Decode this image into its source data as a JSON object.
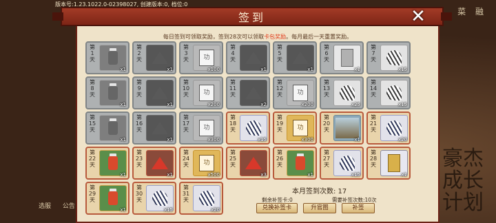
{
  "status": {
    "version_text": "版本号:1.23.1022.0-02398027, 创建版本:0, 档位:0"
  },
  "dialog": {
    "title": "签到",
    "close_label": "✕",
    "info_prefix": "每日签到可领取奖励，签到28次可以领取",
    "info_highlight": "卡包奖励",
    "info_suffix": "。每月最后一天重置奖励。"
  },
  "background": {
    "top_right_glyphs": [
      "菜",
      "融"
    ],
    "bottom_left_glyphs": [
      "选服",
      "公告"
    ],
    "logo_text": "豪杰成长计划"
  },
  "days": [
    {
      "label": "第1天",
      "qty": "x1",
      "item": "lantern",
      "claimed": true
    },
    {
      "label": "第2天",
      "qty": "x1",
      "item": "cloth",
      "claimed": true
    },
    {
      "label": "第3天",
      "qty": "x100",
      "item": "scroll",
      "claimed": true
    },
    {
      "label": "第4天",
      "qty": "x1",
      "item": "cloth",
      "claimed": true
    },
    {
      "label": "第5天",
      "qty": "x1",
      "item": "cloth",
      "claimed": true
    },
    {
      "label": "第6天",
      "qty": "x1",
      "item": "card",
      "claimed": true
    },
    {
      "label": "第7天",
      "qty": "x15",
      "item": "feather",
      "claimed": true
    },
    {
      "label": "第8天",
      "qty": "x1",
      "item": "lantern",
      "claimed": true
    },
    {
      "label": "第9天",
      "qty": "x1",
      "item": "cloth",
      "claimed": true
    },
    {
      "label": "第10天",
      "qty": "x200",
      "item": "scroll",
      "claimed": true
    },
    {
      "label": "第11天",
      "qty": "x2",
      "item": "cloth",
      "claimed": true
    },
    {
      "label": "第12天",
      "qty": "x200",
      "item": "scroll",
      "claimed": true
    },
    {
      "label": "第13天",
      "qty": "x25",
      "item": "feather",
      "claimed": true
    },
    {
      "label": "第14天",
      "qty": "x15",
      "item": "feather",
      "claimed": true
    },
    {
      "label": "第15天",
      "qty": "x1",
      "item": "lantern",
      "claimed": true
    },
    {
      "label": "第16天",
      "qty": "x1",
      "item": "cloth",
      "claimed": true
    },
    {
      "label": "第17天",
      "qty": "x300",
      "item": "scroll",
      "claimed": true
    },
    {
      "label": "第18天",
      "qty": "x15",
      "item": "feather",
      "claimed": false
    },
    {
      "label": "第19天",
      "qty": "x300",
      "item": "scroll",
      "claimed": false
    },
    {
      "label": "第20天",
      "qty": "x1",
      "item": "scene",
      "claimed": false
    },
    {
      "label": "第21天",
      "qty": "x20",
      "item": "feather",
      "claimed": false
    },
    {
      "label": "第22天",
      "qty": "x1",
      "item": "lantern",
      "claimed": false
    },
    {
      "label": "第23天",
      "qty": "x1",
      "item": "cloth",
      "claimed": false
    },
    {
      "label": "第24天",
      "qty": "x500",
      "item": "scroll",
      "claimed": false
    },
    {
      "label": "第25天",
      "qty": "x3",
      "item": "cloth",
      "claimed": false
    },
    {
      "label": "第26天",
      "qty": "x1",
      "item": "lantern",
      "claimed": false
    },
    {
      "label": "第27天",
      "qty": "x15",
      "item": "feather",
      "claimed": false
    },
    {
      "label": "第28天",
      "qty": "x1",
      "item": "card",
      "claimed": false
    },
    {
      "label": "第29天",
      "qty": "x1",
      "item": "lantern",
      "claimed": false
    },
    {
      "label": "第30天",
      "qty": "x15",
      "item": "feather",
      "claimed": false
    },
    {
      "label": "第31天",
      "qty": "x20",
      "item": "feather",
      "claimed": false
    }
  ],
  "summary": {
    "month_count": "本月签到次数: 17",
    "remaining_cards": "剩余补签卡:0",
    "needed_cards": "需要补签次数:10次",
    "buttons": {
      "exchange": "兑换补签卡",
      "upgrade": "升官图",
      "resign": "补签"
    }
  }
}
